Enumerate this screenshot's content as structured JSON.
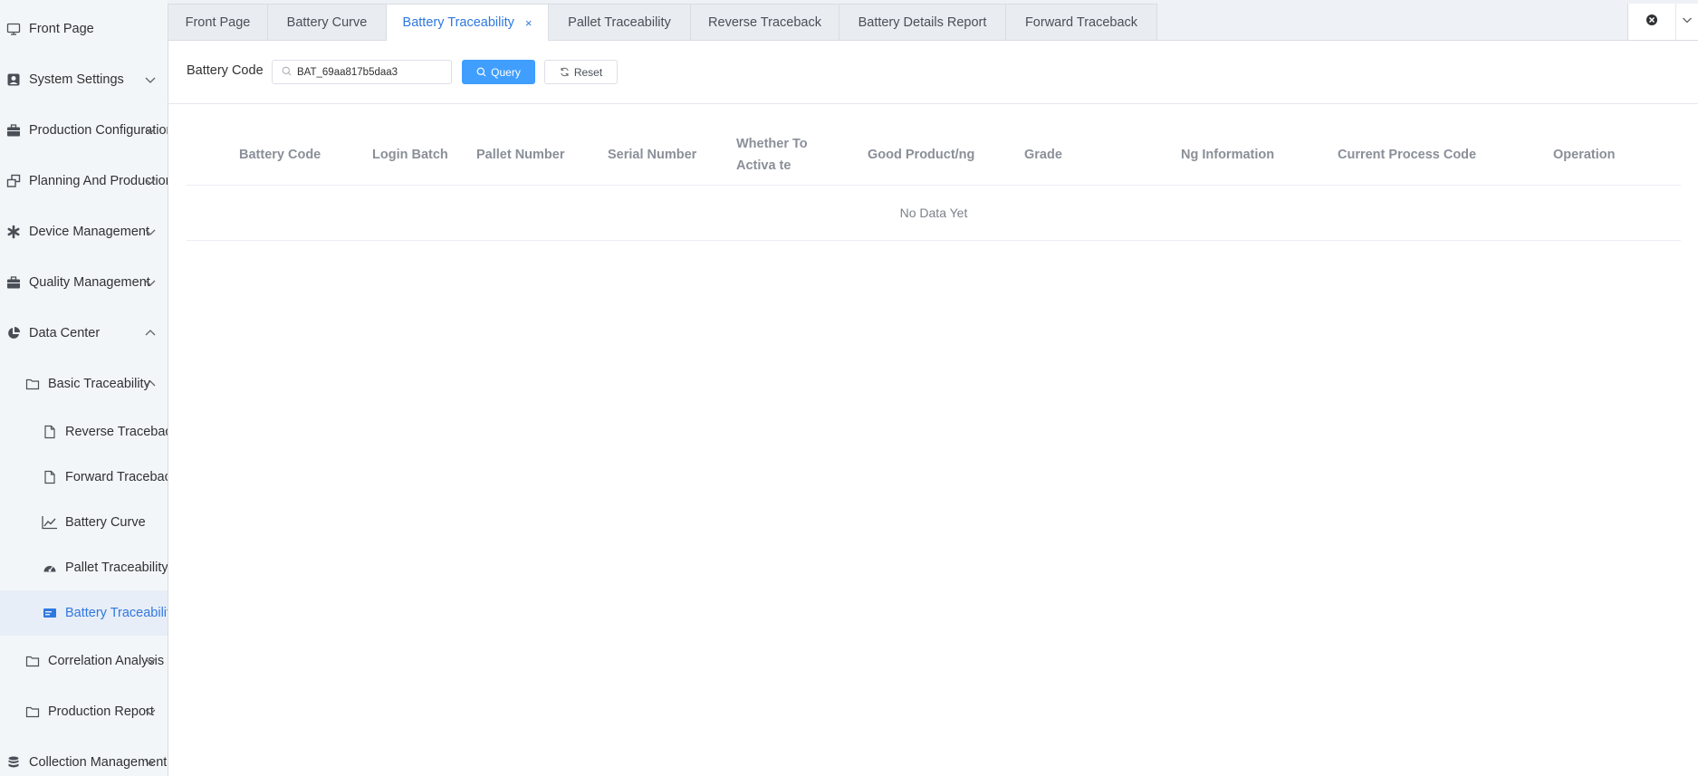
{
  "sidebar": {
    "items": [
      {
        "label": "Front Page",
        "icon": "monitor-icon"
      },
      {
        "label": "System Settings",
        "icon": "user-settings-icon"
      },
      {
        "label": "Production Configuration",
        "icon": "briefcase-icon"
      },
      {
        "label": "Planning And Production",
        "icon": "windows-icon"
      },
      {
        "label": "Device Management",
        "icon": "asterisk-icon"
      },
      {
        "label": "Quality Management",
        "icon": "briefcase-icon"
      },
      {
        "label": "Data Center",
        "icon": "pie-chart-icon"
      },
      {
        "label": "Basic Traceability",
        "icon": "folder-icon"
      },
      {
        "label": "Reverse Traceback",
        "icon": "document-icon"
      },
      {
        "label": "Forward Traceback",
        "icon": "document-icon"
      },
      {
        "label": "Battery Curve",
        "icon": "line-chart-icon"
      },
      {
        "label": "Pallet Traceability",
        "icon": "gauge-icon"
      },
      {
        "label": "Battery Traceability",
        "icon": "card-icon"
      },
      {
        "label": "Correlation Analysis",
        "icon": "folder-icon"
      },
      {
        "label": "Production Report",
        "icon": "folder-icon"
      },
      {
        "label": "Collection Management",
        "icon": "database-icon"
      }
    ]
  },
  "tabs": [
    {
      "label": "Front Page"
    },
    {
      "label": "Battery Curve"
    },
    {
      "label": "Battery Traceability",
      "close": "×"
    },
    {
      "label": "Pallet Traceability"
    },
    {
      "label": "Reverse Traceback"
    },
    {
      "label": "Battery Details Report"
    },
    {
      "label": "Forward Traceback"
    }
  ],
  "query": {
    "label": "Battery Code",
    "value": "BAT_69aa817b5daa3",
    "query_button": "Query",
    "reset_button": "Reset"
  },
  "table": {
    "columns": [
      "Battery Code",
      "Login Batch",
      "Pallet Number",
      "Serial Number",
      "Whether To Activa te",
      "Good Product/ng",
      "Grade",
      "Ng Information",
      "Current Process Code",
      "Operation"
    ],
    "empty_text": "No Data Yet"
  },
  "colors": {
    "accent": "#409eff",
    "active_text": "#2f78e0",
    "sidebar_bg": "#f3f6f8"
  }
}
